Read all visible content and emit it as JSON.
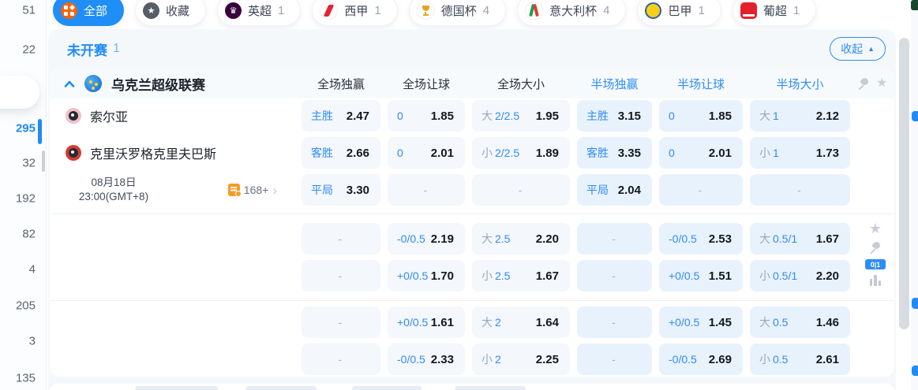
{
  "sidebar": {
    "counts": [
      {
        "value": "51"
      },
      {
        "value": "22"
      },
      {
        "value": "295",
        "active": true
      },
      {
        "value": "32"
      },
      {
        "value": "192"
      },
      {
        "value": "82"
      },
      {
        "value": "4"
      },
      {
        "value": "205"
      },
      {
        "value": "3"
      },
      {
        "value": "135"
      }
    ]
  },
  "tabs": [
    {
      "label": "全部",
      "count": "",
      "icon": "all-grid-icon",
      "active": true
    },
    {
      "label": "收藏",
      "count": "",
      "icon": "favorites-star-icon",
      "active": false
    },
    {
      "label": "英超",
      "count": "1",
      "icon": "premier-league-icon",
      "active": false
    },
    {
      "label": "西甲",
      "count": "1",
      "icon": "laliga-icon",
      "active": false
    },
    {
      "label": "德国杯",
      "count": "4",
      "icon": "german-cup-icon",
      "active": false
    },
    {
      "label": "意大利杯",
      "count": "4",
      "icon": "italy-cup-icon",
      "active": false
    },
    {
      "label": "巴甲",
      "count": "1",
      "icon": "brazil-serie-a-icon",
      "active": false
    },
    {
      "label": "葡超",
      "count": "1",
      "icon": "portugal-league-icon",
      "active": false
    }
  ],
  "section": {
    "title": "未开赛",
    "count": "1",
    "collapse_label": "收起"
  },
  "league": {
    "name": "乌克兰超级联赛",
    "columns": [
      {
        "label": "全场独赢",
        "scope": "full"
      },
      {
        "label": "全场让球",
        "scope": "full"
      },
      {
        "label": "全场大小",
        "scope": "full"
      },
      {
        "label": "半场独赢",
        "scope": "half"
      },
      {
        "label": "半场让球",
        "scope": "half"
      },
      {
        "label": "半场大小",
        "scope": "half"
      }
    ]
  },
  "match": {
    "home_team": "索尔亚",
    "away_team": "克里沃罗格克里夫巴斯",
    "date": "08月18日",
    "time": "23:00(GMT+8)",
    "markets_count": "168+",
    "corner_badge": "0|1"
  },
  "odds_groups": [
    {
      "rows": [
        [
          {
            "label": "主胜",
            "value": "2.47"
          },
          {
            "label": "0",
            "value": "1.85"
          },
          {
            "pre": "大",
            "label": "2/2.5",
            "value": "1.95"
          },
          {
            "label": "主胜",
            "value": "3.15"
          },
          {
            "label": "0",
            "value": "1.85"
          },
          {
            "pre": "大",
            "label": "1",
            "value": "2.12"
          }
        ],
        [
          {
            "label": "客胜",
            "value": "2.66"
          },
          {
            "label": "0",
            "value": "2.01"
          },
          {
            "pre": "小",
            "label": "2/2.5",
            "value": "1.89"
          },
          {
            "label": "客胜",
            "value": "3.35"
          },
          {
            "label": "0",
            "value": "2.01"
          },
          {
            "pre": "小",
            "label": "1",
            "value": "1.73"
          }
        ],
        [
          {
            "label": "平局",
            "value": "3.30"
          },
          {
            "dash": true
          },
          {
            "dash": true
          },
          {
            "label": "平局",
            "value": "2.04"
          },
          {
            "dash": true
          },
          {
            "dash": true
          }
        ]
      ]
    },
    {
      "rows": [
        [
          {
            "dash": true
          },
          {
            "label": "-0/0.5",
            "value": "2.19"
          },
          {
            "pre": "大",
            "label": "2.5",
            "value": "2.20"
          },
          {
            "dash": true
          },
          {
            "label": "-0/0.5",
            "value": "2.53"
          },
          {
            "pre": "大",
            "label": "0.5/1",
            "value": "1.67"
          }
        ],
        [
          {
            "dash": true
          },
          {
            "label": "+0/0.5",
            "value": "1.70"
          },
          {
            "pre": "小",
            "label": "2.5",
            "value": "1.67"
          },
          {
            "dash": true
          },
          {
            "label": "+0/0.5",
            "value": "1.51"
          },
          {
            "pre": "小",
            "label": "0.5/1",
            "value": "2.20"
          }
        ]
      ]
    },
    {
      "rows": [
        [
          {
            "dash": true
          },
          {
            "label": "+0/0.5",
            "value": "1.61"
          },
          {
            "pre": "大",
            "label": "2",
            "value": "1.64"
          },
          {
            "dash": true
          },
          {
            "label": "+0/0.5",
            "value": "1.45"
          },
          {
            "pre": "大",
            "label": "0.5",
            "value": "1.46"
          }
        ],
        [
          {
            "dash": true
          },
          {
            "label": "-0/0.5",
            "value": "2.33"
          },
          {
            "pre": "小",
            "label": "2",
            "value": "2.25"
          },
          {
            "dash": true
          },
          {
            "label": "-0/0.5",
            "value": "2.69"
          },
          {
            "pre": "小",
            "label": "0.5",
            "value": "2.61"
          }
        ]
      ]
    }
  ]
}
